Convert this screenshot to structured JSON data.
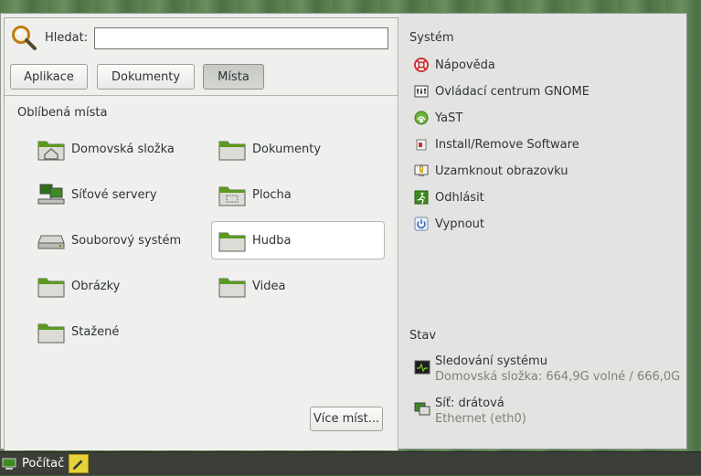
{
  "search": {
    "label": "Hledat:",
    "value": "",
    "placeholder": ""
  },
  "tabs": [
    {
      "label": "Aplikace",
      "active": false
    },
    {
      "label": "Dokumenty",
      "active": false
    },
    {
      "label": "Místa",
      "active": true
    }
  ],
  "places": {
    "title": "Oblíbená místa",
    "items": [
      {
        "label": "Domovská složka",
        "icon": "home-folder-icon"
      },
      {
        "label": "Dokumenty",
        "icon": "folder-icon"
      },
      {
        "label": "Síťové servery",
        "icon": "network-servers-icon"
      },
      {
        "label": "Plocha",
        "icon": "desktop-folder-icon"
      },
      {
        "label": "Souborový systém",
        "icon": "drive-icon"
      },
      {
        "label": "Hudba",
        "icon": "folder-icon",
        "selected": true
      },
      {
        "label": "Obrázky",
        "icon": "folder-icon"
      },
      {
        "label": "Videa",
        "icon": "folder-icon"
      },
      {
        "label": "Stažené",
        "icon": "folder-icon"
      }
    ],
    "more_label": "Více míst..."
  },
  "system": {
    "title": "Systém",
    "items": [
      {
        "label": "Nápověda",
        "icon": "help-lifebuoy-icon"
      },
      {
        "label": "Ovládací centrum GNOME",
        "icon": "control-center-icon"
      },
      {
        "label": "YaST",
        "icon": "yast-icon"
      },
      {
        "label": "Install/Remove Software",
        "icon": "software-install-icon"
      },
      {
        "label": "Uzamknout obrazovku",
        "icon": "lock-screen-icon"
      },
      {
        "label": "Odhlásit",
        "icon": "logout-icon"
      },
      {
        "label": "Vypnout",
        "icon": "power-icon"
      }
    ]
  },
  "status": {
    "title": "Stav",
    "monitor": {
      "label": "Sledování systému",
      "detail": "Domovská složka: 664,9G volné / 666,0G",
      "icon": "system-monitor-icon"
    },
    "network": {
      "label": "Síť: drátová",
      "detail": "Ethernet (eth0)",
      "icon": "network-wired-icon"
    }
  },
  "taskbar": {
    "computer_label": "Počítač",
    "icon": "computer-icon",
    "notes_icon": "sticky-notes-icon"
  },
  "colors": {
    "accent_green": "#4e9a06",
    "selected_bg": "#ffffff",
    "taskbar_bg": "#3b3f38"
  }
}
